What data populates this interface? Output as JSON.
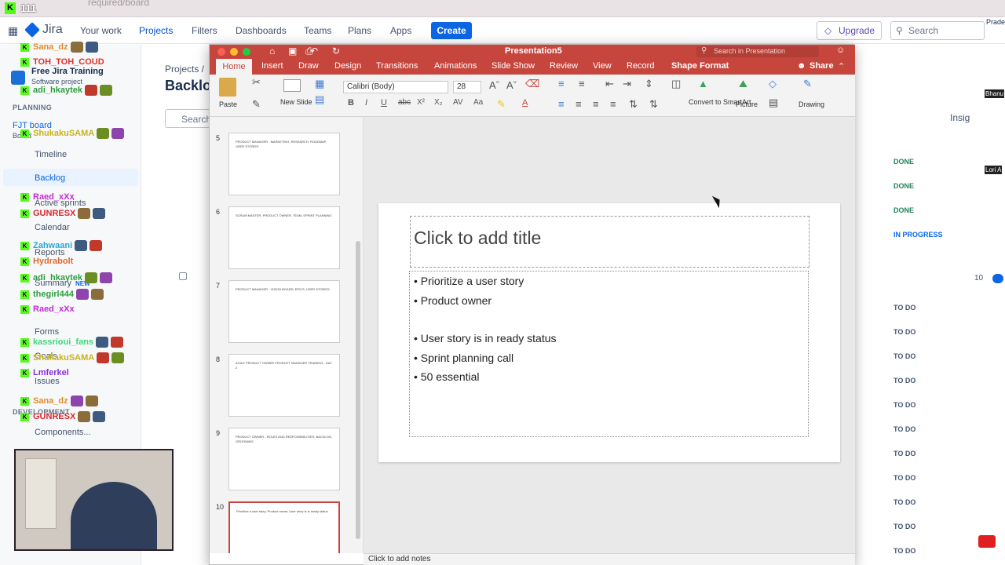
{
  "browser": {
    "url": "required/board",
    "kick_count": "111"
  },
  "jira": {
    "logo": "Jira",
    "nav": [
      "Your work",
      "Projects",
      "Filters",
      "Dashboards",
      "Teams",
      "Plans",
      "Apps"
    ],
    "create": "Create",
    "upgrade": "Upgrade",
    "search_placeholder": "Search",
    "breadcrumb": "Projects /",
    "page_title": "Backlo",
    "board_search": "Search",
    "insights": "Insig",
    "project_name": "Free Jira Training",
    "project_type": "Software project",
    "sidebar": {
      "planning": "PLANNING",
      "board_link": "FJT board",
      "board_sub": "Board",
      "items": [
        "Timeline",
        "Backlog",
        "Active sprints",
        "Calendar",
        "Reports",
        "Summary",
        "Forms",
        "Goals",
        "Issues"
      ],
      "summary_badge": "NEW",
      "development": "DEVELOPMENT",
      "components": "Components..."
    },
    "statuses": [
      "DONE",
      "DONE",
      "DONE",
      "IN PROGRESS",
      "TO DO",
      "TO DO",
      "TO DO",
      "TO DO",
      "TO DO",
      "TO DO",
      "TO DO",
      "TO DO",
      "TO DO",
      "TO DO",
      "TO DO"
    ],
    "right_edge": {
      "name1": "Prade",
      "name2": "Bhanu",
      "name3": "Lori A",
      "count": "10"
    }
  },
  "chat": [
    {
      "user": "Sana_dz",
      "color": "#e08a2c"
    },
    {
      "user": "TOH_TOH_COUD",
      "color": "#e0302c"
    },
    {
      "user": "adi_hkaytek",
      "color": "#2c9e3e"
    },
    {
      "user": "ShukakuSAMA",
      "color": "#c6b21a"
    },
    {
      "user": "Raed_xXx",
      "color": "#c22ad6"
    },
    {
      "user": "GUNRESX",
      "color": "#d6262c"
    },
    {
      "user": "Zahwaani",
      "color": "#26a8d6"
    },
    {
      "user": "Hydrabolt",
      "color": "#e06a2c"
    },
    {
      "user": "adi_hkaytek",
      "color": "#2c9e3e"
    },
    {
      "user": "thegirl444",
      "color": "#2c9e3e"
    },
    {
      "user": "Raed_xXx",
      "color": "#c22ad6"
    },
    {
      "user": "kassrioui_fans",
      "color": "#3ed67a"
    },
    {
      "user": "ShukakuSAMA",
      "color": "#c6b21a"
    },
    {
      "user": "Lmferkel",
      "color": "#8a2cd6"
    },
    {
      "user": "Sana_dz",
      "color": "#e08a2c"
    },
    {
      "user": "GUNRESX",
      "color": "#d6262c"
    }
  ],
  "ppt": {
    "doc_title": "Presentation5",
    "search_placeholder": "Search in Presentation",
    "tabs": [
      "Home",
      "Insert",
      "Draw",
      "Design",
      "Transitions",
      "Animations",
      "Slide Show",
      "Review",
      "View",
      "Record",
      "Shape Format"
    ],
    "share": "Share",
    "ribbon": {
      "paste": "Paste",
      "new_slide": "New Slide",
      "font": "Calibri (Body)",
      "size": "28",
      "convert": "Convert to SmartArt",
      "picture": "Picture",
      "drawing": "Drawing"
    },
    "thumbnails": [
      {
        "num": "5",
        "text": "PRODUCT MANAGER - MARKETING, RESEARCH, ROADMAP, USER STORIES"
      },
      {
        "num": "6",
        "text": "SCRUM MASTER, PRODUCT OWNER, TEAM, SPRINT PLANNING"
      },
      {
        "num": "7",
        "text": "PRODUCT MANAGER - VISION BOARD, EPICS, USER STORIES"
      },
      {
        "num": "8",
        "text": "AGILE PRODUCT OWNER PRODUCT MANAGER TRAINING - DAY 2"
      },
      {
        "num": "9",
        "text": "PRODUCT OWNER - ROLES AND RESPONSIBILITIES, BACKLOG, GROOMING"
      },
      {
        "num": "10",
        "text": "Prioritize a user story, Product owner, User story is in ready status"
      }
    ],
    "slide_title": "Click to add title",
    "bullets": [
      "Prioritize a user story",
      "Product owner",
      "",
      "User story is in ready status",
      "Sprint planning call",
      "50 essential"
    ],
    "notes": "Click to add notes"
  },
  "colors": {
    "ppt_accent": "#c6463d",
    "jira_blue": "#0c66e4",
    "done": "#1f845a",
    "inprogress": "#0c66e4"
  }
}
